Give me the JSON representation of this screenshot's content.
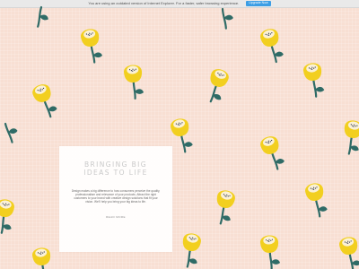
{
  "browser_notice": {
    "text": "You are using an outdated version of Internet Explorer. For a faster, safer browsing experience.",
    "button_label": "Upgrade Now"
  },
  "hero": {
    "headline_line1": "BRINGING BIG",
    "headline_line2": "IDEAS TO LIFE",
    "body": "Design makes a big difference to how consumers perceive the quality, professionalism and relevance of your products. Attract the right customers to your brand with creative design solutions that fit your vision. We'll help you bring your big ideas to life.",
    "read_more_label": "READ MORE"
  },
  "colors": {
    "background": "#f8dfd3",
    "flower_yellow": "#f2cf1f",
    "flower_center": "#fbf1d6",
    "stem_teal": "#2f6b66",
    "dots": "#1f2b4b"
  },
  "icons": {
    "pattern": "yellow-flower-icon"
  }
}
